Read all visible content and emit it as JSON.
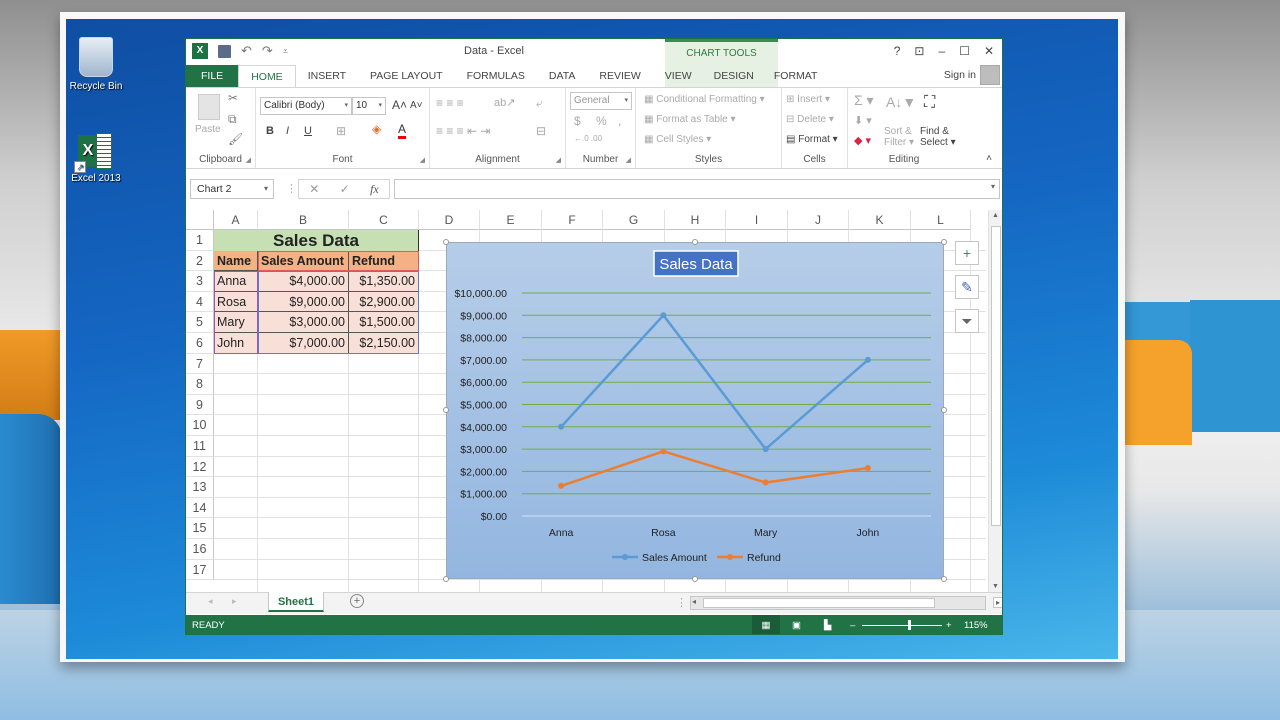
{
  "desktop": {
    "icons": [
      {
        "label": "Recycle Bin",
        "icon": "recycle-bin-icon"
      },
      {
        "label": "Excel 2013",
        "icon": "excel-shortcut-icon"
      }
    ]
  },
  "window": {
    "title": "Data - Excel",
    "context_group": "CHART TOOLS",
    "controls": {
      "help": "?",
      "ribbon_display": "⊡",
      "minimize": "–",
      "maximize": "☐",
      "close": "✕"
    },
    "sign_in": "Sign in"
  },
  "tabs": [
    {
      "label": "FILE"
    },
    {
      "label": "HOME",
      "active": true
    },
    {
      "label": "INSERT"
    },
    {
      "label": "PAGE LAYOUT"
    },
    {
      "label": "FORMULAS"
    },
    {
      "label": "DATA"
    },
    {
      "label": "REVIEW"
    },
    {
      "label": "VIEW"
    },
    {
      "label": "DESIGN"
    },
    {
      "label": "FORMAT"
    }
  ],
  "ribbon": {
    "clipboard": {
      "label": "Clipboard",
      "paste": "Paste"
    },
    "font": {
      "label": "Font",
      "font_name": "Calibri (Body)",
      "font_size": "10",
      "bold": "B",
      "italic": "I",
      "underline": "U"
    },
    "alignment": {
      "label": "Alignment"
    },
    "number": {
      "label": "Number",
      "format": "General",
      "currency": "$",
      "percent": "%",
      "comma": ","
    },
    "styles": {
      "label": "Styles",
      "conditional": "Conditional Formatting",
      "format_table": "Format as Table",
      "cell_styles": "Cell Styles"
    },
    "cells": {
      "label": "Cells",
      "insert": "Insert",
      "delete": "Delete",
      "format": "Format"
    },
    "editing": {
      "label": "Editing",
      "sort1": "Sort &",
      "sort2": "Filter",
      "find1": "Find &",
      "find2": "Select"
    }
  },
  "formula_bar": {
    "name_box": "Chart 2",
    "fx": "fx",
    "value": ""
  },
  "columns": [
    "A",
    "B",
    "C",
    "D",
    "E",
    "F",
    "G",
    "H",
    "I",
    "J",
    "K",
    "L"
  ],
  "rows": [
    "1",
    "2",
    "3",
    "4",
    "5",
    "6",
    "7",
    "8",
    "9",
    "10",
    "11",
    "12",
    "13",
    "14",
    "15",
    "16",
    "17"
  ],
  "sheet": {
    "title": "Sales Data",
    "headers": [
      "Name",
      "Sales Amount",
      "Refund"
    ],
    "data": [
      [
        "Anna",
        "$4,000.00",
        "$1,350.00"
      ],
      [
        "Rosa",
        "$9,000.00",
        "$2,900.00"
      ],
      [
        "Mary",
        "$3,000.00",
        "$1,500.00"
      ],
      [
        "John",
        "$7,000.00",
        "$2,150.00"
      ]
    ]
  },
  "sheet_tabs": {
    "active": "Sheet1"
  },
  "status": {
    "mode": "READY",
    "zoom": "115%",
    "zoom_level": 0.57
  },
  "colors": {
    "accent": "#217346",
    "series_sales": "#5b9bd5",
    "series_refund": "#ed7d31",
    "chart_bg": "#a7c3e6",
    "title_bg": "#4472c4"
  },
  "chart_data": {
    "type": "line",
    "title": "Sales Data",
    "categories": [
      "Anna",
      "Rosa",
      "Mary",
      "John"
    ],
    "series": [
      {
        "name": "Sales Amount",
        "values": [
          4000,
          9000,
          3000,
          7000
        ]
      },
      {
        "name": "Refund",
        "values": [
          1350,
          2900,
          1500,
          2150
        ]
      }
    ],
    "ylim": [
      0,
      10000
    ],
    "yticks": [
      "$0.00",
      "$1,000.00",
      "$2,000.00",
      "$3,000.00",
      "$4,000.00",
      "$5,000.00",
      "$6,000.00",
      "$7,000.00",
      "$8,000.00",
      "$9,000.00",
      "$10,000.00"
    ],
    "xlabel": "",
    "ylabel": "",
    "grid": true,
    "legend": "bottom"
  }
}
